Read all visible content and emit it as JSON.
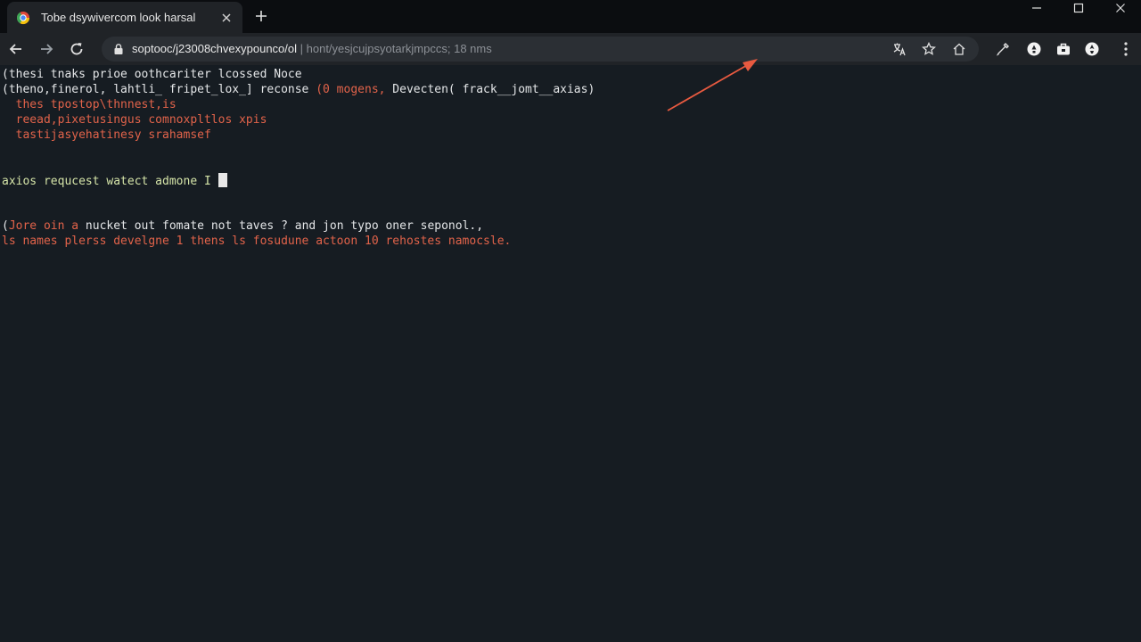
{
  "browser": {
    "tab": {
      "title": "Tobe dsywivercom look harsal"
    },
    "address_bar": {
      "url_main": "soptooc/j23008chvexypounco/ol",
      "url_rest": " | hont/yesjcujpsyotarkjmpccs; 18 nms"
    },
    "colors": {
      "tab_strip": "#0b0d10",
      "toolbar": "#202327",
      "omnibox": "#2b2f34",
      "page_bg": "#161c22"
    },
    "icons": [
      "chrome-favicon",
      "close-icon",
      "plus-icon",
      "minimize-icon",
      "maximize-icon",
      "window-close-icon",
      "back-icon",
      "forward-icon",
      "reload-icon",
      "lock-icon",
      "translate-icon",
      "star-icon",
      "home-icon",
      "pen-icon",
      "extension-icon",
      "briefcase-icon",
      "profile-icon",
      "kebab-menu-icon"
    ]
  },
  "terminal": {
    "line1": "(thesi tnaks prioe oothcariter lcossed Noce",
    "line2_a": "(theno,finerol, lahtli_ fripet_lox_] reconse ",
    "line2_b": "(0 mogens,",
    "line2_c": " Devecten( frack__jomt__axias)",
    "line3": "  thes tpostop\\thnnest,is",
    "line4": "  reead,pixetusingus comnoxpltlos xpis",
    "line5": "  tastijasyehatinesy srahamsef",
    "line6": "axios requcest watect admone I ",
    "line7_a": "(",
    "line7_b": "Jore oin a",
    "line7_c": " nucket out fomate not taves ? and jon typo oner seponol.,",
    "line8": "ls names plerss develgne 1 thens ls fosudune actoon 10 rehostes namocsle.",
    "colors": {
      "text": "#e4e6e8",
      "accent": "#e2634a",
      "prompt": "#d5e4a8",
      "arrow": "#e85a40"
    }
  }
}
